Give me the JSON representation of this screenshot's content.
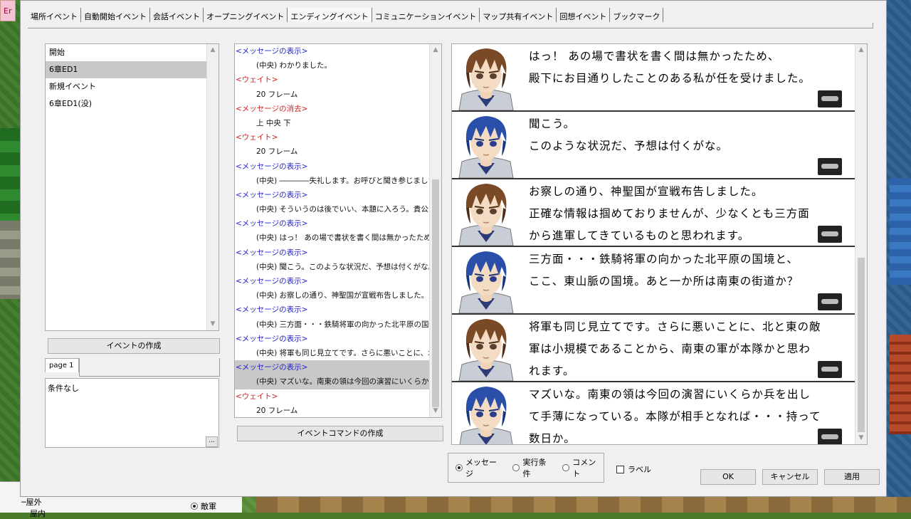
{
  "tabs": [
    "場所イベント",
    "自動開始イベント",
    "会話イベント",
    "オープニングイベント",
    "エンディングイベント",
    "コミュニケーションイベント",
    "マップ共有イベント",
    "回想イベント",
    "ブックマーク"
  ],
  "active_tab_index": 4,
  "event_list": [
    "開始",
    "6章ED1",
    "新規イベント",
    "6章ED1(没)"
  ],
  "event_list_selected_index": 1,
  "create_event_button": "イベントの作成",
  "page_tab": "page 1",
  "condition_text": "条件なし",
  "dots_button": "...",
  "command_list": [
    {
      "kind": "head",
      "text": "<メッセージの表示>",
      "color": "blue"
    },
    {
      "kind": "body",
      "text": "(中央) わかりました。"
    },
    {
      "kind": "head",
      "text": "<ウェイト>",
      "color": "red"
    },
    {
      "kind": "body",
      "text": "20 フレーム"
    },
    {
      "kind": "head",
      "text": "<メッセージの消去>",
      "color": "red"
    },
    {
      "kind": "body",
      "text": "上 中央 下"
    },
    {
      "kind": "head",
      "text": "<ウェイト>",
      "color": "red"
    },
    {
      "kind": "body",
      "text": "20 フレーム"
    },
    {
      "kind": "head",
      "text": "<メッセージの表示>",
      "color": "blue"
    },
    {
      "kind": "body",
      "text": "(中央) ――――失礼します。お呼びと聞き参じました。陛"
    },
    {
      "kind": "head",
      "text": "<メッセージの表示>",
      "color": "blue"
    },
    {
      "kind": "body",
      "text": "(中央) そういうのは後でいい、本題に入ろう。貴公は鉄"
    },
    {
      "kind": "head",
      "text": "<メッセージの表示>",
      "color": "blue"
    },
    {
      "kind": "body",
      "text": "(中央) はっ！ あの場で書状を書く間は無かったため、殿"
    },
    {
      "kind": "head",
      "text": "<メッセージの表示>",
      "color": "blue"
    },
    {
      "kind": "body",
      "text": "(中央) 聞こう。このような状況だ、予想は付くがな。"
    },
    {
      "kind": "head",
      "text": "<メッセージの表示>",
      "color": "blue"
    },
    {
      "kind": "body",
      "text": "(中央) お察しの通り、神聖国が宣戦布告しました。正"
    },
    {
      "kind": "head",
      "text": "<メッセージの表示>",
      "color": "blue"
    },
    {
      "kind": "body",
      "text": "(中央) 三方面・・・鉄騎将軍の向かった北平原の国境"
    },
    {
      "kind": "head",
      "text": "<メッセージの表示>",
      "color": "blue"
    },
    {
      "kind": "body",
      "text": "(中央) 将軍も同じ見立てです。さらに悪いことに、北と東"
    },
    {
      "kind": "head",
      "text": "<メッセージの表示>",
      "color": "blue",
      "selected": true
    },
    {
      "kind": "body",
      "text": "(中央) マズいな。南東の領は今回の演習にいくらか兵を",
      "selected": true
    },
    {
      "kind": "head",
      "text": "<ウェイト>",
      "color": "red"
    },
    {
      "kind": "body",
      "text": "20 フレーム"
    }
  ],
  "create_command_button": "イベントコマンドの作成",
  "preview_messages": [
    {
      "face": "brown",
      "lines": [
        "はっ！ あの場で書状を書く間は無かったため、",
        "殿下にお目通りしたことのある私が任を受けました。"
      ]
    },
    {
      "face": "blue",
      "lines": [
        "聞こう。",
        "このような状況だ、予想は付くがな。"
      ]
    },
    {
      "face": "brown",
      "lines": [
        "お察しの通り、神聖国が宣戦布告しました。",
        "正確な情報は掴めておりませんが、少なくとも三方面",
        "から進軍してきているものと思われます。"
      ]
    },
    {
      "face": "blue",
      "lines": [
        "三方面・・・鉄騎将軍の向かった北平原の国境と、",
        "ここ、東山脈の国境。あと一か所は南東の街道か？"
      ]
    },
    {
      "face": "brown",
      "lines": [
        "将軍も同じ見立てです。さらに悪いことに、北と東の敵",
        "軍は小規模であることから、南東の軍が本隊かと思わ",
        "れます。"
      ]
    },
    {
      "face": "blue",
      "lines": [
        "マズいな。南東の領は今回の演習にいくらか兵を出し",
        "て手薄になっている。本隊が相手となれば・・・持って",
        "数日か。"
      ]
    }
  ],
  "radio_options": [
    "メッセージ",
    "実行条件",
    "コメント"
  ],
  "radio_selected_index": 0,
  "label_checkbox": "ラベル",
  "buttons": {
    "ok": "OK",
    "cancel": "キャンセル",
    "apply": "適用"
  },
  "bg_tree": {
    "item1": "屋外",
    "item2": "屋内"
  },
  "bg_radio": "敵軍",
  "bg_tab_letter": "Er"
}
